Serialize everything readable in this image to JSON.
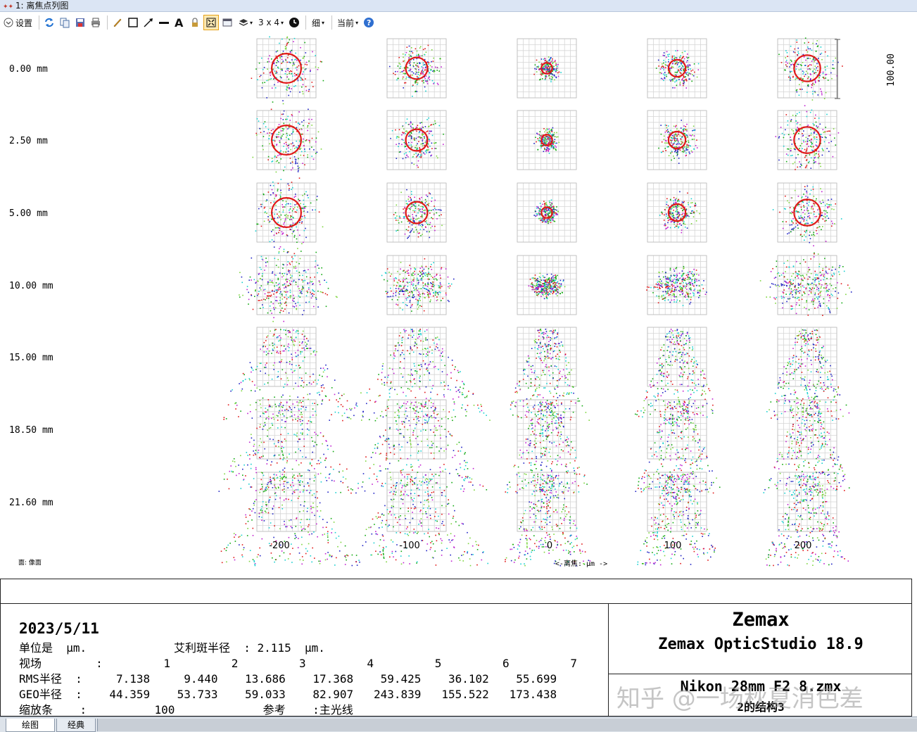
{
  "window": {
    "title": "1: 离焦点列图"
  },
  "toolbar": {
    "settings_label": "设置",
    "layout_label": "3 x 4",
    "line_label": "细",
    "current_label": "当前",
    "icons": [
      "refresh-icon",
      "copy-icon",
      "save-icon",
      "print-icon",
      "pencil-icon",
      "rectangle-icon",
      "arrow-icon",
      "line-icon",
      "text-icon",
      "lock-icon",
      "fit-icon",
      "window-icon",
      "layers-icon",
      "clock-icon",
      "help-icon"
    ]
  },
  "plot": {
    "field_labels": [
      "0.00  mm",
      "2.50  mm",
      "5.00  mm",
      "10.00  mm",
      "15.00  mm",
      "18.50  mm",
      "21.60  mm"
    ],
    "defocus_ticks": [
      "-200",
      "-100",
      "0",
      "100",
      "200"
    ],
    "axis_caption": "<-离焦: µm ->",
    "surface_label": "面: 像面",
    "scale_bar_label": "100.00",
    "colors": [
      "#1f22c4",
      "#10a810",
      "#e01818",
      "#16cfcf",
      "#c01fd0",
      "#7bd43a"
    ]
  },
  "info": {
    "date": "2023/5/11",
    "unit_line": "单位是  µm.",
    "airy_line": "艾利斑半径  : 2.115  µm.",
    "field_line": "视场        :         1         2         3         4         5         6         7",
    "rms_line": "RMS半径  :     7.138     9.440    13.686    17.368    59.425    36.102    55.699",
    "geo_line": "GEO半径  :    44.359    53.733    59.033    82.907   243.839   155.522   173.438",
    "scale_line": "缩放条    :          100             参考    :主光线"
  },
  "titleblock": {
    "brand": "Zemax",
    "product": "Zemax OpticStudio 18.9",
    "file": "Nikon 28mm F2 8.zmx",
    "config": "2的结构3",
    "watermark": "知乎 @一场秋夏消色差"
  },
  "tabs": [
    "绘图",
    "经典"
  ]
}
